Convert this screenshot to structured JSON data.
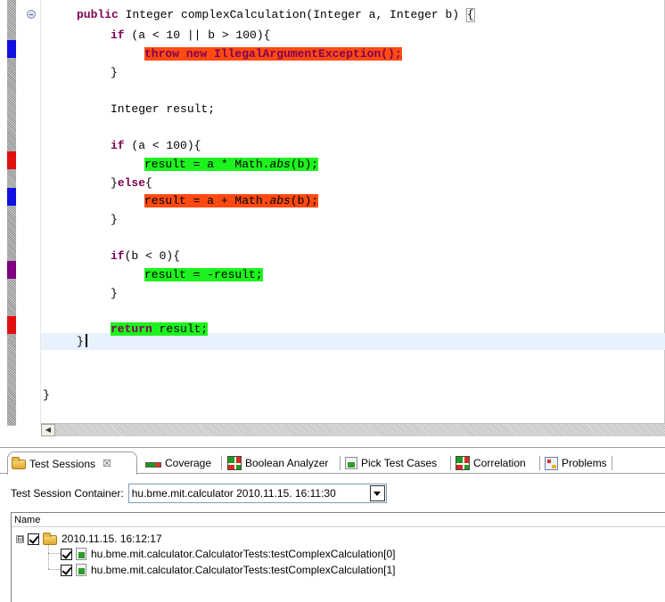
{
  "editor": {
    "code": {
      "method_kw": "public",
      "method_sig": " Integer complexCalculation(Integer a, Integer b) ",
      "open_brace": "{",
      "if1_kw": "if",
      "if1_cond": " (a < 10 || b > 100){",
      "throw_stmt": "throw new IllegalArgumentException();",
      "close1": "}",
      "decl": "Integer result;",
      "if2_kw": "if",
      "if2_cond": " (a < 100){",
      "assign1_pre": "result = a * Math.",
      "assign1_fn": "abs",
      "assign1_post": "(b);",
      "else_pre": "}",
      "else_kw": "else",
      "else_post": "{",
      "assign2_pre": "result = a + Math.",
      "assign2_fn": "abs",
      "assign2_post": "(b);",
      "close2": "}",
      "if3_kw": "if",
      "if3_cond": "(b < 0){",
      "assign3": "result = -result;",
      "close3": "}",
      "return_kw": "return",
      "return_rest": " result;",
      "method_close": "}",
      "class_close": "}"
    },
    "highlight_colors": {
      "uncovered": "#ff4a12",
      "covered": "#1ef21e"
    },
    "ruler_markers": [
      {
        "color": "#1010e0"
      },
      {
        "color": "#e01010"
      },
      {
        "color": "#1010e0"
      },
      {
        "color": "#800080"
      },
      {
        "color": "#e01010"
      }
    ],
    "hscroll_left_icon": "left-arrow-icon"
  },
  "views": {
    "tabs": [
      {
        "label": "Test Sessions",
        "icon": "folder-icon",
        "active": true,
        "close": "☒"
      },
      {
        "label": "Coverage",
        "icon": "coverage-bar-icon"
      },
      {
        "label": "Boolean Analyzer",
        "icon": "grid-icon"
      },
      {
        "label": "Pick Test Cases",
        "icon": "pick-icon"
      },
      {
        "label": "Correlation",
        "icon": "grid-icon"
      },
      {
        "label": "Problems",
        "icon": "problems-icon"
      }
    ],
    "container_label": "Test Session Container:",
    "container_value": "hu.bme.mit.calculator 2010.11.15. 16:11:30",
    "tree": {
      "column_header": "Name",
      "session": {
        "label": "2010.11.15. 16:12:17",
        "expander": "⊟",
        "checked": true
      },
      "tests": [
        {
          "label": "hu.bme.mit.calculator.CalculatorTests:testComplexCalculation[0]",
          "checked": true
        },
        {
          "label": "hu.bme.mit.calculator.CalculatorTests:testComplexCalculation[1]",
          "checked": true
        }
      ]
    }
  }
}
